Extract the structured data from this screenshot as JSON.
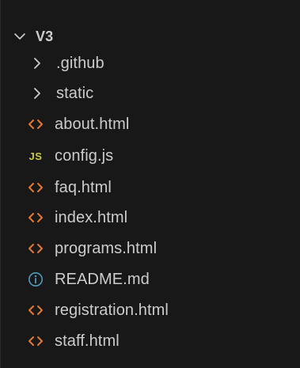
{
  "explorer": {
    "root": {
      "label": "V3",
      "icon": "chevron-down-icon",
      "expanded": true
    },
    "folders": [
      {
        "label": ".github",
        "icon": "chevron-right-icon"
      },
      {
        "label": "static",
        "icon": "chevron-right-icon"
      }
    ],
    "files": [
      {
        "label": "about.html",
        "icon": "html-file-icon"
      },
      {
        "label": "config.js",
        "icon": "js-file-icon",
        "badge": "JS"
      },
      {
        "label": "faq.html",
        "icon": "html-file-icon"
      },
      {
        "label": "index.html",
        "icon": "html-file-icon"
      },
      {
        "label": "programs.html",
        "icon": "html-file-icon"
      },
      {
        "label": "README.md",
        "icon": "info-icon"
      },
      {
        "label": "registration.html",
        "icon": "html-file-icon"
      },
      {
        "label": "staff.html",
        "icon": "html-file-icon"
      }
    ],
    "colors": {
      "background": "#181818",
      "text": "#cccccc",
      "html_icon": "#e37933",
      "js_icon": "#cbcb41",
      "info_icon": "#519aba"
    }
  }
}
